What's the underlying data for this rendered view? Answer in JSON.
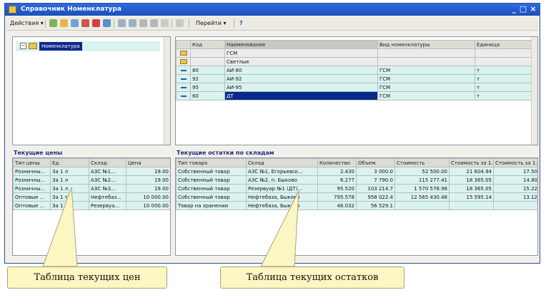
{
  "window": {
    "title": "Справочник Номенклатура",
    "controls": [
      "_",
      "□",
      "×"
    ]
  },
  "toolbar": {
    "actions_label": "Действия ▾",
    "goto_label": "Перейти ▾",
    "help_label": "?"
  },
  "tree": {
    "root_label": "Номенклатура"
  },
  "main_table": {
    "columns": [
      "Код",
      "Наименование",
      "Вид номенклатуры",
      "Единица"
    ],
    "rows": [
      {
        "type": "group",
        "code": "",
        "name": "ГСМ",
        "kind": "",
        "unit": ""
      },
      {
        "type": "group",
        "code": "",
        "name": "Светлые",
        "kind": "",
        "unit": ""
      },
      {
        "type": "item",
        "code": "80",
        "name": "АИ-80",
        "kind": "ГСМ",
        "unit": "т"
      },
      {
        "type": "item",
        "code": "92",
        "name": "АИ-92",
        "kind": "ГСМ",
        "unit": "т"
      },
      {
        "type": "item",
        "code": "95",
        "name": "АИ-95",
        "kind": "ГСМ",
        "unit": "т"
      },
      {
        "type": "item",
        "code": "60",
        "name": "ДТ",
        "kind": "ГСМ",
        "unit": "т"
      }
    ]
  },
  "prices": {
    "title": "Текущие цены",
    "columns": [
      "Тип цены",
      "Ед.",
      "Склад",
      "Цена"
    ],
    "rows": [
      [
        "Розничны...",
        "За 1 л",
        "АЗС №1...",
        "19.00"
      ],
      [
        "Розничны...",
        "За 1 л",
        "АЗС №2...",
        "19.00"
      ],
      [
        "Розничны...",
        "За 1 л",
        "АЗС №3...",
        "19.00"
      ],
      [
        "Оптовые ...",
        "За 1 т",
        "Нефтебаз...",
        "10 000.00"
      ],
      [
        "Оптовые ...",
        "За 1 т",
        "Резервуа...",
        "10 000.00"
      ]
    ]
  },
  "stock": {
    "title": "Текущие остатки по складам",
    "columns": [
      "Тип товара",
      "Склад",
      "Количество",
      "Объем",
      "Стоимость",
      "Стоимость за 1...",
      "Стоимость за 1..."
    ],
    "rows": [
      [
        "Собственный товар",
        "АЗС №1, Егорьевск...",
        "2.430",
        "3 000.0",
        "52 500.00",
        "21 604.94",
        "17.50"
      ],
      [
        "Собственный товар",
        "АЗС №2, п. Быково",
        "6.277",
        "7 790.0",
        "115 277.41",
        "18 365.05",
        "14.80"
      ],
      [
        "Собственный товар",
        "Резервуар №1 (ДТ)...",
        "95.520",
        "103 214.7",
        "1 570 578.98",
        "18 365.05",
        "15.22"
      ],
      [
        "Собственный товар",
        "Нефтебаза, Быково",
        "795.578",
        "958 022.4",
        "12 565 430.48",
        "15 595.14",
        "13.12"
      ],
      [
        "Товар на хранении",
        "Нефтебаза, Быково",
        "46.032",
        "56 529.1",
        "",
        "",
        ""
      ]
    ]
  },
  "callouts": {
    "prices_label": "Таблица текущих цен",
    "stock_label": "Таблица текущих остатков"
  }
}
